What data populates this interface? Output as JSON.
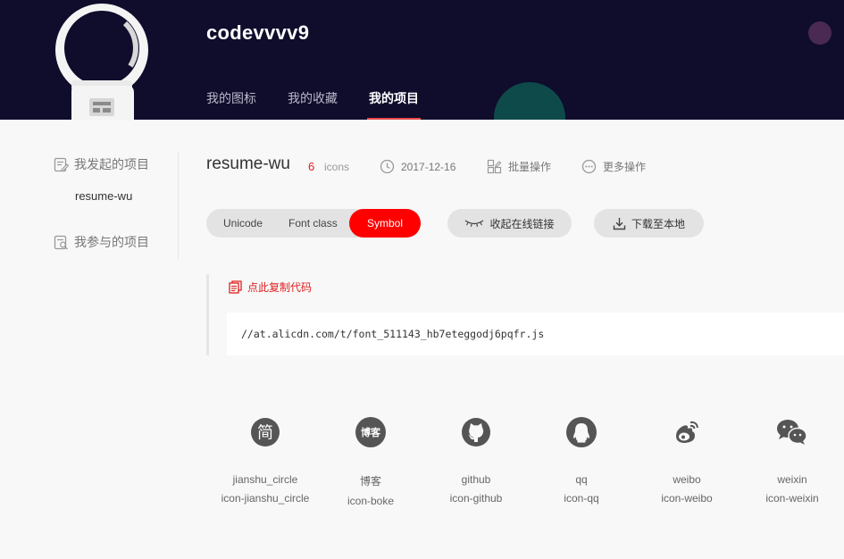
{
  "header": {
    "username": "codevvvv9",
    "nav": [
      {
        "label": "我的图标"
      },
      {
        "label": "我的收藏"
      },
      {
        "label": "我的项目",
        "active": true
      }
    ],
    "accent_color": "#e64a4a",
    "background": "#0f0c2c"
  },
  "sidebar": {
    "initiated_label": "我发起的项目",
    "projects": [
      "resume-wu"
    ],
    "joined_label": "我参与的项目"
  },
  "project": {
    "name": "resume-wu",
    "count": "6",
    "count_unit": "icons",
    "date": "2017-12-16",
    "batch_label": "批量操作",
    "more_label": "更多操作"
  },
  "tabs": {
    "unicode": "Unicode",
    "font_class": "Font class",
    "symbol": "Symbol",
    "active": "Symbol"
  },
  "actions": {
    "collapse_link": "收起在线链接",
    "download": "下载至本地"
  },
  "code": {
    "copy_label": "点此复制代码",
    "url": "//at.alicdn.com/t/font_511143_hb7eteggodj6pqfr.js"
  },
  "icons": [
    {
      "name": "jianshu_circle",
      "code": "icon-jianshu_circle",
      "icon": "jianshu-icon",
      "glyph": "简"
    },
    {
      "name": "博客",
      "code": "icon-boke",
      "icon": "blog-icon",
      "glyph": "博客"
    },
    {
      "name": "github",
      "code": "icon-github",
      "icon": "github-icon"
    },
    {
      "name": "qq",
      "code": "icon-qq",
      "icon": "qq-icon"
    },
    {
      "name": "weibo",
      "code": "icon-weibo",
      "icon": "weibo-icon"
    },
    {
      "name": "weixin",
      "code": "icon-weixin",
      "icon": "wechat-icon"
    }
  ],
  "colors": {
    "primary_red": "#ff0000",
    "icon_gray": "#555555"
  }
}
